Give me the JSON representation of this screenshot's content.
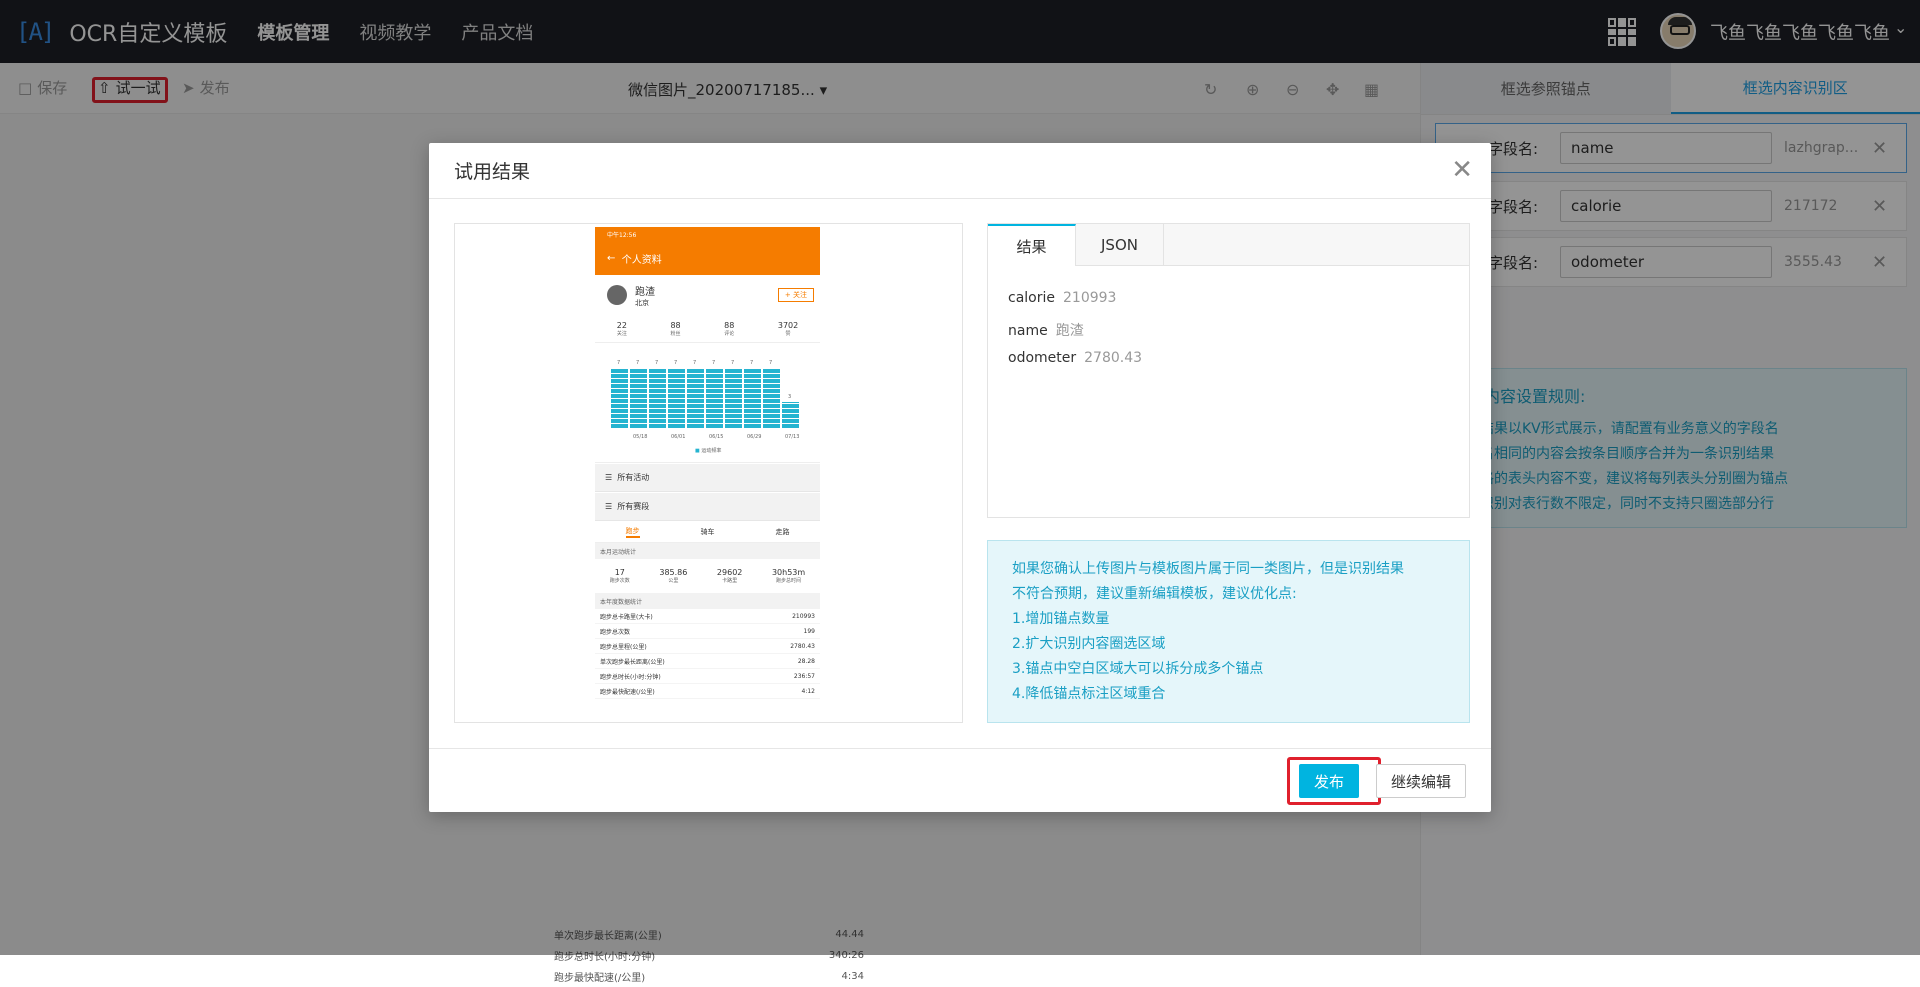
{
  "header": {
    "logo_mark": "[A]",
    "title": "OCR自定义模板",
    "nav": [
      "模板管理",
      "视频教学",
      "产品文档"
    ],
    "user_name": "飞鱼飞鱼飞鱼飞鱼飞鱼"
  },
  "toolbar": {
    "save_label": "保存",
    "try_label": "试一试",
    "publish_label": "发布",
    "file_name": "微信图片_20200717185..."
  },
  "right_panel": {
    "tabs": [
      "框选参照锚点",
      "框选内容识别区"
    ],
    "field_label": "字段名:",
    "fields": [
      {
        "name": "name",
        "value": "lazhgrap..."
      },
      {
        "name": "calorie",
        "value": "217172"
      },
      {
        "name": "odometer",
        "value": "3555.43"
      }
    ],
    "rules_title": "识别内容设置规则:",
    "rules": [
      "识别结果以KV形式展示，请配置有业务意义的字段名",
      "字段名相同的内容会按条目顺序合并为一条识别结果",
      "若表格的表头内容不变，建议将每列表头分别圈为锚点",
      "表格识别对表行数不限定，同时不支持只圈选部分行"
    ]
  },
  "background_rows": [
    {
      "label": "单次跑步最长距离(公里)",
      "value": "44.44"
    },
    {
      "label": "跑步总时长(小时:分钟)",
      "value": "340:26"
    },
    {
      "label": "跑步最快配速(/公里)",
      "value": "4:34"
    }
  ],
  "modal": {
    "title": "试用结果",
    "result_tabs": [
      "结果",
      "JSON"
    ],
    "results": [
      {
        "key": "calorie",
        "value": "210993"
      },
      {
        "key": "name",
        "value": "跑渣"
      },
      {
        "key": "odometer",
        "value": "2780.43"
      }
    ],
    "advice": [
      "如果您确认上传图片与模板图片属于同一类图片，但是识别结果",
      "不符合预期，建议重新编辑模板，建议优化点:",
      "1.增加锚点数量",
      "2.扩大识别内容圈选区域",
      "3.锚点中空白区域大可以拆分成多个锚点",
      "4.降低锚点标注区域重合"
    ],
    "publish_label": "发布",
    "continue_label": "继续编辑"
  },
  "phone": {
    "status": "中午12:56",
    "title": "个人资料",
    "user": "跑渣",
    "city": "北京",
    "follow": "+ 关注",
    "stats": [
      {
        "v": "22",
        "l": "关注"
      },
      {
        "v": "88",
        "l": "粉丝"
      },
      {
        "v": "88",
        "l": "评论"
      },
      {
        "v": "3702",
        "l": "赞"
      }
    ],
    "bars": [
      7,
      7,
      7,
      7,
      7,
      7,
      7,
      7,
      7,
      3
    ],
    "xticks": [
      "05/18",
      "06/01",
      "06/15",
      "06/29",
      "07/13"
    ],
    "legend": "运动频率",
    "menus": [
      "所有活动",
      "所有赛段"
    ],
    "sport_tabs": [
      "跑步",
      "骑车",
      "走路"
    ],
    "month_title": "本月运动统计",
    "month_stats": [
      {
        "v": "17",
        "l": "跑步次数"
      },
      {
        "v": "385.86",
        "l": "公里"
      },
      {
        "v": "29602",
        "l": "卡路里"
      },
      {
        "v": "30h53m",
        "l": "跑步总时间"
      }
    ],
    "year_title": "本年度数据统计",
    "year_rows": [
      {
        "l": "跑步总卡路里(大卡)",
        "v": "210993"
      },
      {
        "l": "跑步总次数",
        "v": "199"
      },
      {
        "l": "跑步总里程(公里)",
        "v": "2780.43"
      },
      {
        "l": "单次跑步最长距离(公里)",
        "v": "28.28"
      },
      {
        "l": "跑步总时长(小时:分钟)",
        "v": "236:57"
      },
      {
        "l": "跑步最快配速(/公里)",
        "v": "4:12"
      }
    ]
  }
}
